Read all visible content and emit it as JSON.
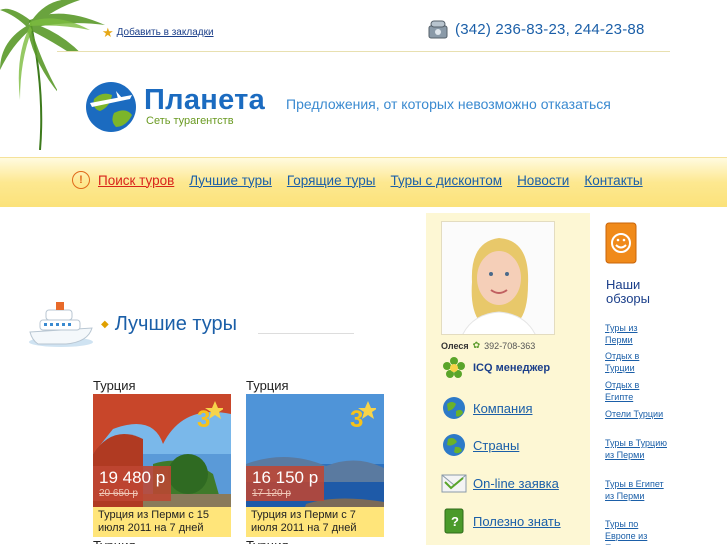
{
  "header": {
    "bookmark_label": "Добавить в закладки",
    "phone": "(342) 236-83-23, 244-23-88",
    "logo_name": "Планета",
    "logo_sub": "Сеть турагентств",
    "slogan": "Предложения, от которых невозможно отказаться"
  },
  "nav": {
    "items": [
      {
        "label": "Поиск туров",
        "active": true
      },
      {
        "label": "Лучшие туры"
      },
      {
        "label": "Горящие туры"
      },
      {
        "label": "Туры с дисконтом"
      },
      {
        "label": "Новости"
      },
      {
        "label": "Контакты"
      }
    ]
  },
  "section": {
    "title": "Лучшие туры"
  },
  "tours": [
    {
      "country": "Турция",
      "stars": "3",
      "price": "19 480 р",
      "old_price": "20 650 р",
      "caption": "Турция из Перми с 15 июля 2011 на 7 дней",
      "next_country": "Турция"
    },
    {
      "country": "Турция",
      "stars": "3",
      "price": "16 150 р",
      "old_price": "17 120 р",
      "caption": "Турция из Перми с 7 июля 2011 на 7 дней",
      "next_country": "Турция"
    }
  ],
  "manager": {
    "name": "Олеся",
    "icq_number": "392-708-363",
    "icq_label": "ICQ менеджер"
  },
  "side_links": [
    {
      "label": "Компания",
      "icon": "globe-icon"
    },
    {
      "label": "Страны",
      "icon": "globe-icon"
    },
    {
      "label": "On-line заявка",
      "icon": "envelope-icon"
    },
    {
      "label": "Полезно знать",
      "icon": "book-icon"
    }
  ],
  "reviews": {
    "title_line1": "Наши",
    "title_line2": "обзоры",
    "links": [
      "Туры из Перми",
      "Отдых в Турции",
      "Отдых в Египте",
      "Отели Турции",
      "Туры в Турцию из Перми",
      "Туры в Египет из Перми",
      "Туры по Европе из Перми"
    ]
  },
  "colors": {
    "brand_blue": "#1b6bc0",
    "link_blue": "#1b5fa8",
    "active_red": "#d8231b",
    "nav_yellow": "#fde890",
    "price_bg": "#be4632",
    "caption_yellow": "#ffe57a"
  }
}
